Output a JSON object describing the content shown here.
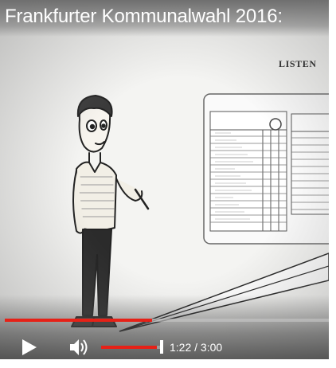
{
  "video": {
    "title": "Frankfurter Kommunalwahl 2016:",
    "heading": "LISTEN",
    "progress_fraction": 0.454,
    "volume_fraction": 0.95,
    "current_time": "1:22",
    "separator": "/",
    "duration": "3:00"
  },
  "colors": {
    "accent": "#e62117"
  },
  "icons": {
    "play": "play-icon",
    "volume": "volume-icon"
  }
}
